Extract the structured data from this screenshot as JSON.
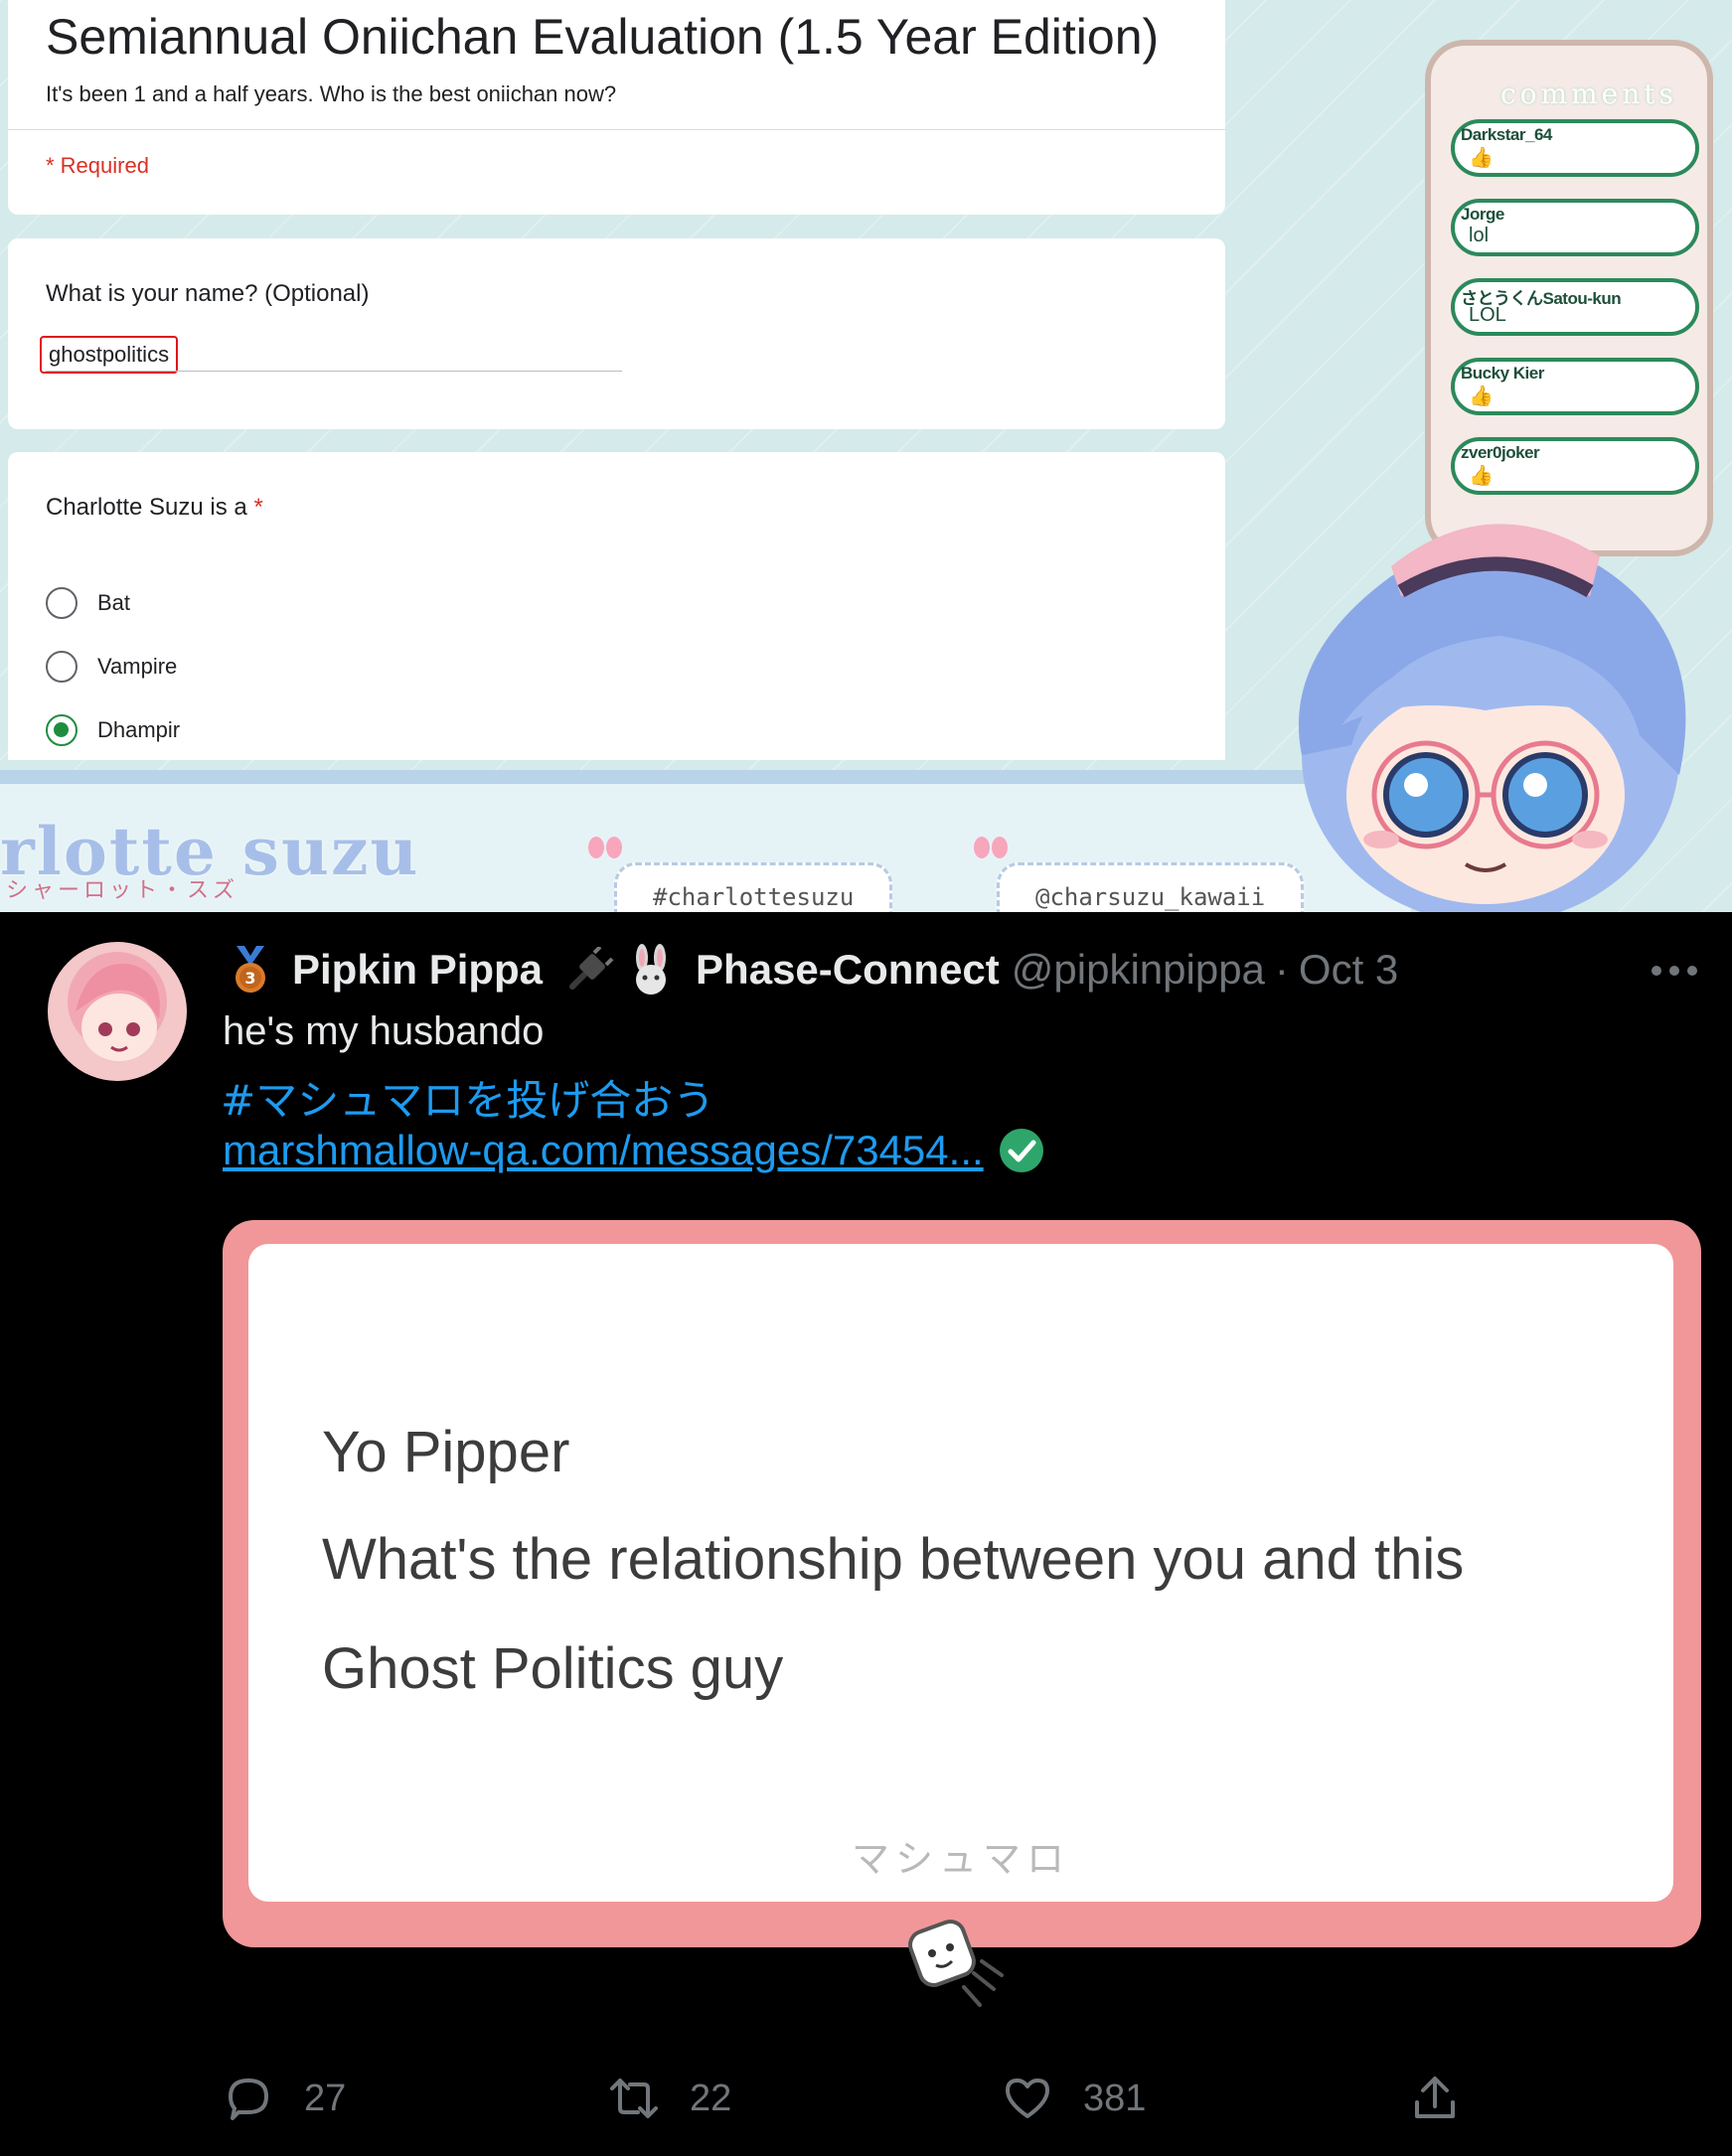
{
  "stream": {
    "form": {
      "title": "Semiannual Oniichan Evaluation (1.5 Year Edition)",
      "description": "It's been 1 and a half years. Who is the best oniichan now?",
      "required_note": "* Required",
      "q1": {
        "label": "What is your name? (Optional)",
        "value": "ghostpolitics"
      },
      "q2": {
        "label": "Charlotte Suzu is a",
        "required_star": "*",
        "options": [
          "Bat",
          "Vampire",
          "Dhampir"
        ],
        "selected": "Dhampir"
      }
    },
    "comments": {
      "title": "comments",
      "items": [
        {
          "user": "Darkstar_64",
          "text": "👍"
        },
        {
          "user": "Jorge",
          "text": "lol"
        },
        {
          "user": "さとうくんSatou-kun",
          "text": "LOL"
        },
        {
          "user": "Bucky Kier",
          "text": "👍"
        },
        {
          "user": "zver0joker",
          "text": "👍"
        }
      ]
    },
    "brand": {
      "logo": "rlotte suzu",
      "sub": "シャーロット・スズ"
    },
    "tabs": {
      "hashtag": "#charlottesuzu",
      "handle": "@charsuzu_kawaii"
    },
    "colors": {
      "background": "#d5eaea",
      "required_red": "#d93025",
      "radio_green": "#1e8e3e",
      "highlight_box": "#e0141a"
    }
  },
  "tweet": {
    "display_name": "Pipkin Pippa",
    "affiliation": "Phase-Connect",
    "handle": "@pipkinpippa",
    "separator": "·",
    "date": "Oct 3",
    "text": "he's my husbando",
    "hashtag": "#マシュマロを投げ合おう",
    "link": "marshmallow-qa.com/messages/73454...",
    "icons": {
      "badge": "medal-3-icon",
      "plug": "plug-icon",
      "bunny": "bunny-icon",
      "verified": "check-circle-icon",
      "more": "more-icon"
    },
    "card": {
      "lines": [
        "Yo Pipper",
        "What's the relationship between you and this",
        "Ghost Politics guy"
      ],
      "brand": "マシュマロ"
    },
    "actions": {
      "replies": "27",
      "retweets": "22",
      "likes": "381"
    },
    "colors": {
      "background": "#000000",
      "text": "#e7e9ea",
      "muted": "#71767b",
      "link": "#1d9bf0",
      "card_pink": "#f19799"
    }
  }
}
